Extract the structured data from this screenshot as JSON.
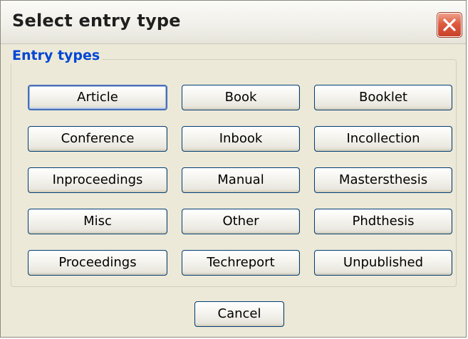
{
  "window": {
    "title": "Select entry type"
  },
  "group": {
    "legend": "Entry types"
  },
  "entry_types": [
    "Article",
    "Book",
    "Booklet",
    "Conference",
    "Inbook",
    "Incollection",
    "Inproceedings",
    "Manual",
    "Mastersthesis",
    "Misc",
    "Other",
    "Phdthesis",
    "Proceedings",
    "Techreport",
    "Unpublished"
  ],
  "footer": {
    "cancel_label": "Cancel"
  },
  "colors": {
    "dialog_bg": "#ece9d8",
    "legend_text": "#0046d5",
    "button_border": "#003c74",
    "close_red": "#de5c40"
  }
}
